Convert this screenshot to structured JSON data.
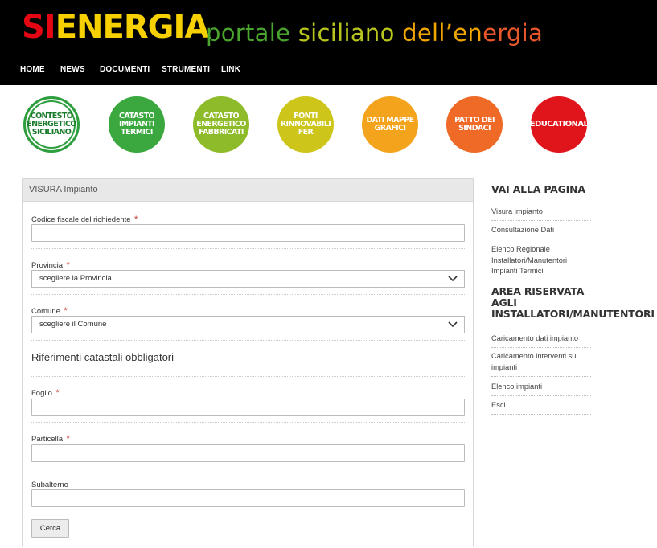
{
  "header": {
    "logo_si": "SI",
    "logo_energia": "ENERGIA",
    "tagline": [
      "portale",
      "siciliano",
      "dell’en",
      "ergia"
    ]
  },
  "nav": [
    "HOME",
    "NEWS",
    "DOCUMENTI",
    "STRUMENTI",
    "LINK"
  ],
  "circles": [
    {
      "label": "CONTESTO ENERGETICO SICILIANO",
      "color": "#2e9e3f"
    },
    {
      "label": "CATASTO IMPIANTI TERMICI",
      "color": "#3aa83f"
    },
    {
      "label": "CATASTO ENERGETICO FABBRICATI",
      "color": "#8dbb2a"
    },
    {
      "label": "FONTI RINNOVABILI FER",
      "color": "#cdc51a"
    },
    {
      "label": "DATI MAPPE GRAFICI",
      "color": "#f3a31c"
    },
    {
      "label": "PATTO DEI SINDACI",
      "color": "#ee6a26"
    },
    {
      "label": "EDUCATIONAL",
      "color": "#e0141b"
    }
  ],
  "form": {
    "title": "VISURA Impianto",
    "codice_label": "Codice fiscale del richiedente",
    "provincia_label": "Provincia",
    "provincia_value": "scegliere la Provincia",
    "comune_label": "Comune",
    "comune_value": "scegliere il Comune",
    "section_title": "Riferimenti catastali obbligatori",
    "foglio_label": "Foglio",
    "particella_label": "Particella",
    "subalterno_label": "Subalterno",
    "required_mark": "*",
    "submit_label": "Cerca"
  },
  "sidebar": {
    "heading1": "VAI ALLA PAGINA",
    "links1": [
      "Visura impianto",
      "Consultazione Dati",
      "Elenco Regionale Installatori/Manutentori Impianti Termici"
    ],
    "heading2_lines": [
      "AREA RISERVATA",
      "AGLI",
      "INSTALLATORI/MANUTENTORI"
    ],
    "links2": [
      "Caricamento dati impianto",
      "Caricamento interventi su impianti",
      "Elenco impianti",
      "Esci"
    ]
  }
}
